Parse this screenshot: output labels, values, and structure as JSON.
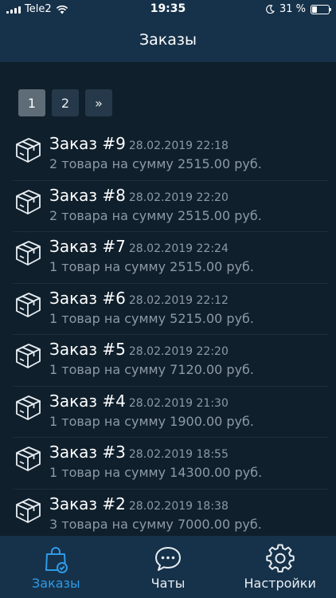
{
  "status_bar": {
    "carrier": "Tele2",
    "time": "19:35",
    "battery": "31 %",
    "battery_level": 0.31
  },
  "header": {
    "title": "Заказы"
  },
  "pagination": {
    "pages": [
      "1",
      "2"
    ],
    "next_label": "»",
    "current": "1"
  },
  "orders": [
    {
      "name": "Заказ #9",
      "date": "28.02.2019 22:18",
      "summary": "2 товара на сумму 2515.00 руб."
    },
    {
      "name": "Заказ #8",
      "date": "28.02.2019 22:20",
      "summary": "2 товара на сумму 2515.00 руб."
    },
    {
      "name": "Заказ #7",
      "date": "28.02.2019 22:24",
      "summary": "1 товар на сумму 2515.00 руб."
    },
    {
      "name": "Заказ #6",
      "date": "28.02.2019 22:12",
      "summary": "1 товар на сумму 5215.00 руб."
    },
    {
      "name": "Заказ #5",
      "date": "28.02.2019 22:20",
      "summary": "1 товар на сумму 7120.00 руб."
    },
    {
      "name": "Заказ #4",
      "date": "28.02.2019 21:30",
      "summary": "1 товар на сумму 1900.00 руб."
    },
    {
      "name": "Заказ #3",
      "date": "28.02.2019 18:55",
      "summary": "1 товар на сумму 14300.00 руб."
    },
    {
      "name": "Заказ #2",
      "date": "28.02.2019 18:38",
      "summary": "3 товара на сумму 7000.00 руб."
    }
  ],
  "tab_bar": {
    "tabs": [
      {
        "label": "Заказы",
        "icon": "shopping-bag-check-icon",
        "active": true
      },
      {
        "label": "Чаты",
        "icon": "chat-bubble-icon",
        "active": false
      },
      {
        "label": "Настройки",
        "icon": "gear-icon",
        "active": false
      }
    ]
  },
  "colors": {
    "background": "#0f1f2c",
    "bar": "#16324a",
    "accent": "#2f9be6",
    "secondary_text": "#8d9aa6"
  }
}
